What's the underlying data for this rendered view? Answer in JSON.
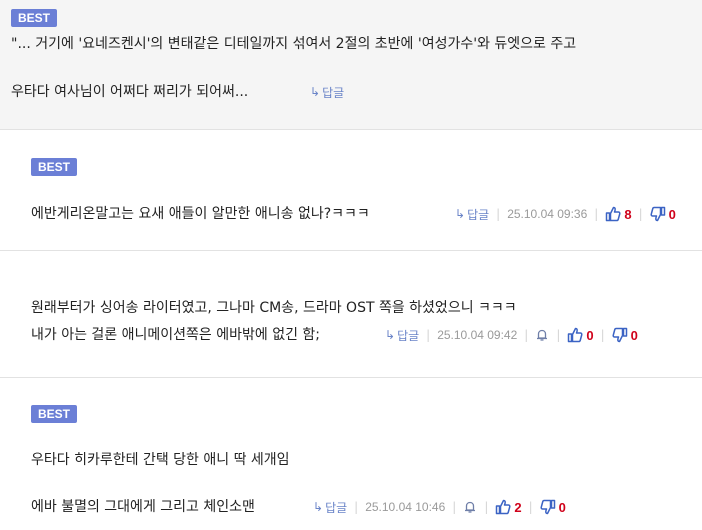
{
  "comments": [
    {
      "badge": "BEST",
      "lines": [
        "\"... 거기에 '요네즈켄시'의 변태같은 디테일까지 섞여서 2절의 초반에 '여성가수'와 듀엣으로 주고",
        "우타다 여사님이 어쩌다 쩌리가 되어써..."
      ],
      "reply_label": "답글"
    },
    {
      "badge": "BEST",
      "lines": [
        "에반게리온말고는 요새 애들이 알만한 애니송 없나?ㅋㅋㅋ"
      ],
      "reply_label": "답글",
      "date": "25.10.04 09:36",
      "up": "8",
      "down": "0"
    },
    {
      "lines": [
        "원래부터가 싱어송 라이터였고, 그나마 CM송, 드라마 OST 쪽을 하셨었으니 ㅋㅋㅋ",
        "내가 아는 걸론 애니메이션쪽은 에바밖에 없긴 함;"
      ],
      "reply_label": "답글",
      "date": "25.10.04 09:42",
      "up": "0",
      "down": "0"
    },
    {
      "badge": "BEST",
      "lines": [
        "우타다 히카루한테 간택 당한 애니 딱 세개임",
        "에바 불멸의 그대에게 그리고 체인소맨"
      ],
      "reply_label": "답글",
      "date": "25.10.04 10:46",
      "up": "2",
      "down": "0"
    }
  ],
  "colors": {
    "badge": "#6b7fd6",
    "reply": "#6a84c8",
    "count": "#d0021b",
    "icon": "#3b63c4",
    "date": "#9a9a9a"
  },
  "icons": [
    "reply-arrow-icon",
    "bell-icon",
    "thumbs-up-icon",
    "thumbs-down-icon"
  ]
}
